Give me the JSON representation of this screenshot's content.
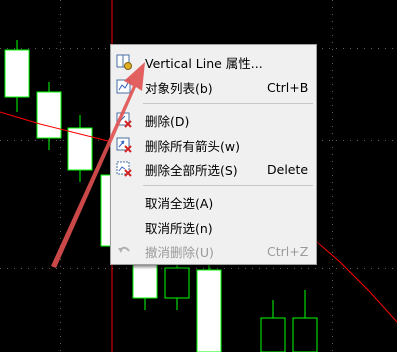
{
  "colors": {
    "background": "#000000",
    "bull_candle": "#ffffff",
    "candle_outline": "#00ff00",
    "moving_average": "#ff0000",
    "vertical_line": "#ff0000",
    "grid": "#606060",
    "annotation_arrow": "#e05050"
  },
  "context_menu": {
    "items": [
      {
        "label": "Vertical Line 属性...",
        "shortcut": "",
        "icon": "vertical-line-properties-icon",
        "disabled": false
      },
      {
        "label": "对象列表(b)",
        "shortcut": "Ctrl+B",
        "icon": "object-list-icon",
        "disabled": false
      },
      {
        "label": "删除(D)",
        "shortcut": "",
        "icon": "delete-icon",
        "disabled": false
      },
      {
        "label": "删除所有箭头(w)",
        "shortcut": "",
        "icon": "delete-all-arrows-icon",
        "disabled": false
      },
      {
        "label": "删除全部所选(S)",
        "shortcut": "Delete",
        "icon": "delete-all-selected-icon",
        "disabled": false
      },
      {
        "label": "取消全选(A)",
        "shortcut": "",
        "icon": "",
        "disabled": false
      },
      {
        "label": "取消所选(n)",
        "shortcut": "",
        "icon": "",
        "disabled": false
      },
      {
        "label": "撤消删除(U)",
        "shortcut": "Ctrl+Z",
        "icon": "undo-icon",
        "disabled": true
      }
    ]
  }
}
